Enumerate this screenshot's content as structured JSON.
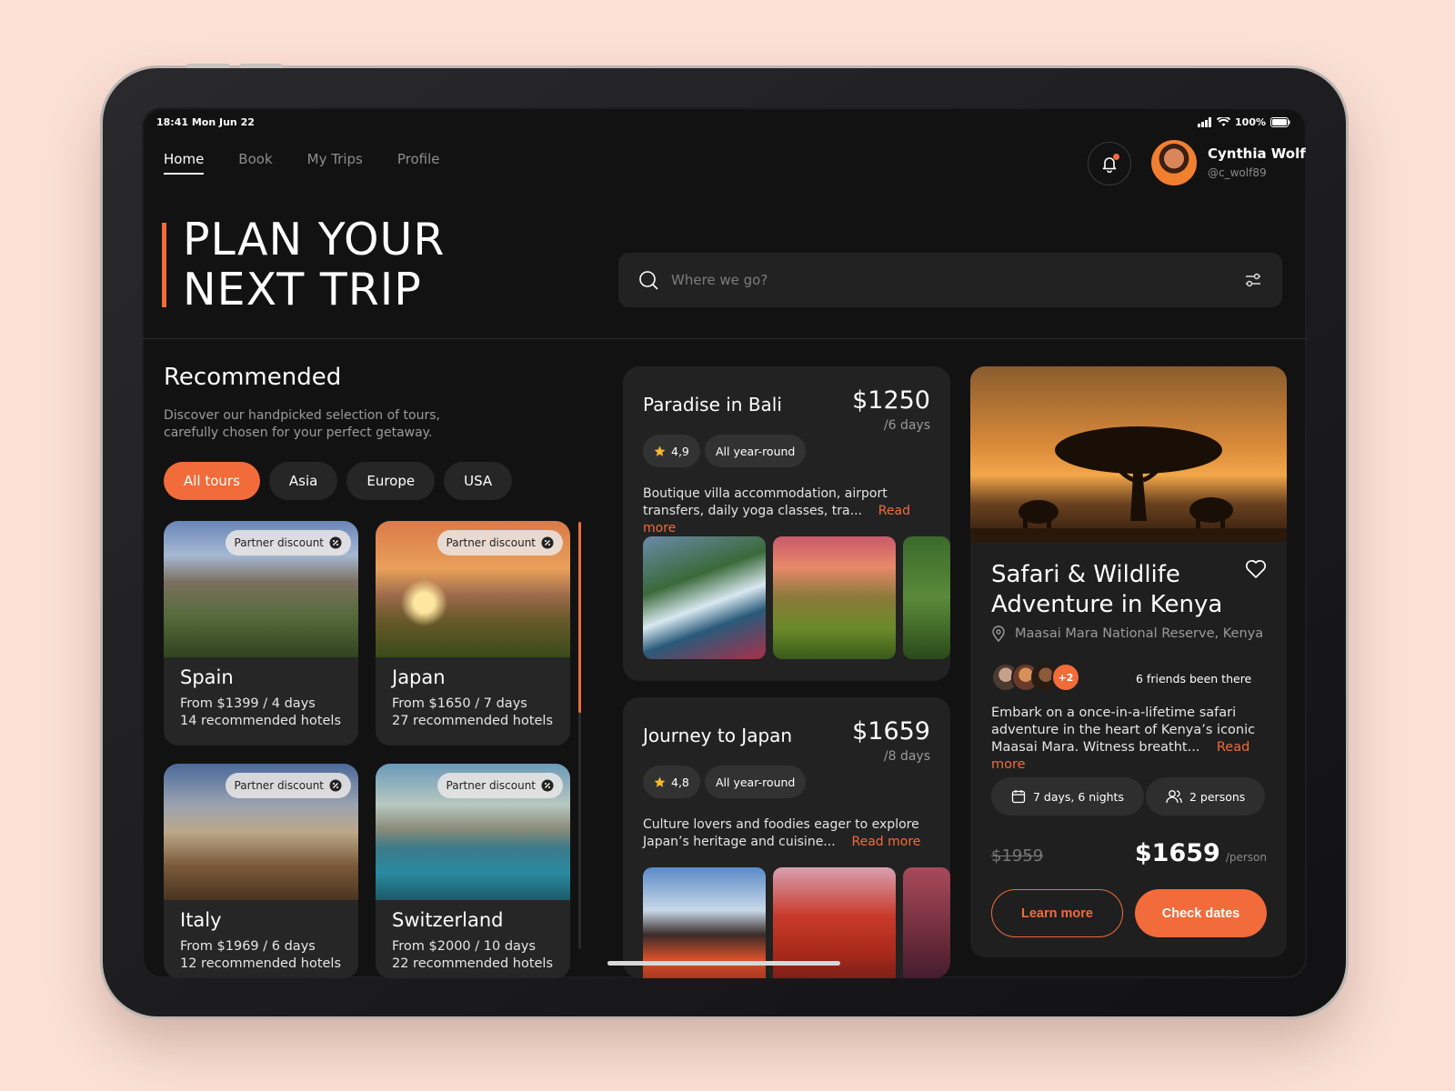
{
  "status": {
    "time": "18:41 Mon Jun 22",
    "battery": "100%"
  },
  "nav": [
    "Home",
    "Book",
    "My Trips",
    "Profile"
  ],
  "user": {
    "name": "Cynthia Wolf",
    "handle": "@c_wolf89"
  },
  "hero": {
    "title": "PLAN YOUR\nNEXT TRIP"
  },
  "search": {
    "placeholder": "Where we go?"
  },
  "recommended": {
    "title": "Recommended",
    "description": "Discover our handpicked selection of tours, carefully chosen for your perfect getaway.",
    "chips": [
      "All tours",
      "Asia",
      "Europe",
      "USA"
    ],
    "badge": "Partner discount",
    "destinations": [
      {
        "name": "Spain",
        "price": "From $1399 / 4 days",
        "hotels": "14 recommended hotels"
      },
      {
        "name": "Japan",
        "price": "From $1650 / 7 days",
        "hotels": "27 recommended hotels"
      },
      {
        "name": "Italy",
        "price": "From $1969 / 6 days",
        "hotels": "12 recommended hotels"
      },
      {
        "name": "Switzerland",
        "price": "From $2000 / 10 days",
        "hotels": "22 recommended hotels"
      }
    ]
  },
  "tours": [
    {
      "name": "Paradise in Bali",
      "price": "$1250",
      "days": "/6 days",
      "rating": "4,9",
      "season": "All year-round",
      "description": "Boutique villa accommodation, airport transfers, daily yoga classes, tra...",
      "read_more": "Read more"
    },
    {
      "name": "Journey to Japan",
      "price": "$1659",
      "days": "/8 days",
      "rating": "4,8",
      "season": "All year-round",
      "description": "Culture lovers and foodies eager to explore Japan’s heritage and cuisine...",
      "read_more": "Read more"
    }
  ],
  "featured": {
    "title": "Safari & Wildlife Adventure in Kenya",
    "location": "Maasai Mara National Reserve, Kenya",
    "friends_more": "+2",
    "friends_label": "6 friends been there",
    "description": "Embark on a once-in-a-lifetime safari adventure in the heart of Kenya’s iconic Maasai Mara. Witness breatht...",
    "read_more": "Read more",
    "duration": "7 days, 6 nights",
    "persons": "2 persons",
    "old_price": "$1959",
    "price": "$1659",
    "per": "/person",
    "learn_more": "Learn more",
    "check_dates": "Check dates"
  },
  "colors": {
    "accent": "#f26b3a",
    "background": "#121212",
    "card": "#222222"
  }
}
